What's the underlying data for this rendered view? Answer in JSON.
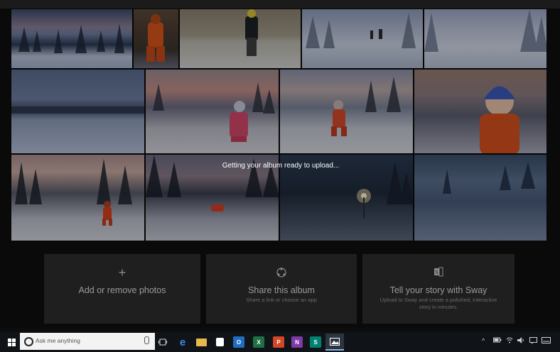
{
  "status_text": "Getting your album ready to upload...",
  "photos": [
    {
      "desc": "snowy-forest-sunset"
    },
    {
      "desc": "child-orange-snowsuit"
    },
    {
      "desc": "child-black-yellow-jacket"
    },
    {
      "desc": "snowy-forest-walkers"
    },
    {
      "desc": "snowy-trees-trail"
    },
    {
      "desc": "snowy-field-horizon"
    },
    {
      "desc": "child-pink-snow"
    },
    {
      "desc": "child-red-walking"
    },
    {
      "desc": "child-blue-hat-portrait"
    },
    {
      "desc": "child-red-forest"
    },
    {
      "desc": "child-red-sledding"
    },
    {
      "desc": "night-streetlight"
    },
    {
      "desc": "dusk-snow-slope"
    }
  ],
  "actions": [
    {
      "icon": "+",
      "title": "Add or remove photos",
      "subtitle": ""
    },
    {
      "icon": "share",
      "title": "Share this album",
      "subtitle": "Share a link or choose an app"
    },
    {
      "icon": "sway",
      "title": "Tell your story with Sway",
      "subtitle": "Upload to Sway and create a polished, interactive story in minutes."
    }
  ],
  "taskbar": {
    "search_placeholder": "Ask me anything",
    "apps": [
      {
        "name": "task-view",
        "label": ""
      },
      {
        "name": "edge",
        "label": "e",
        "color": "#3277bc"
      },
      {
        "name": "file-explorer",
        "label": "",
        "color": "#e8b84a"
      },
      {
        "name": "store",
        "label": "",
        "color": "#ffffff"
      },
      {
        "name": "outlook",
        "label": "O",
        "color": "#1e6fbf"
      },
      {
        "name": "excel",
        "label": "X",
        "color": "#1e7145"
      },
      {
        "name": "powerpoint",
        "label": "P",
        "color": "#d24726"
      },
      {
        "name": "onenote",
        "label": "N",
        "color": "#7e3aa6"
      },
      {
        "name": "sway",
        "label": "S",
        "color": "#008272"
      },
      {
        "name": "photos",
        "label": "",
        "color": "#ffffff"
      }
    ]
  },
  "colors": {
    "accent": "#ffffff",
    "card": "#1f1f1f",
    "taskbar": "#101418"
  }
}
